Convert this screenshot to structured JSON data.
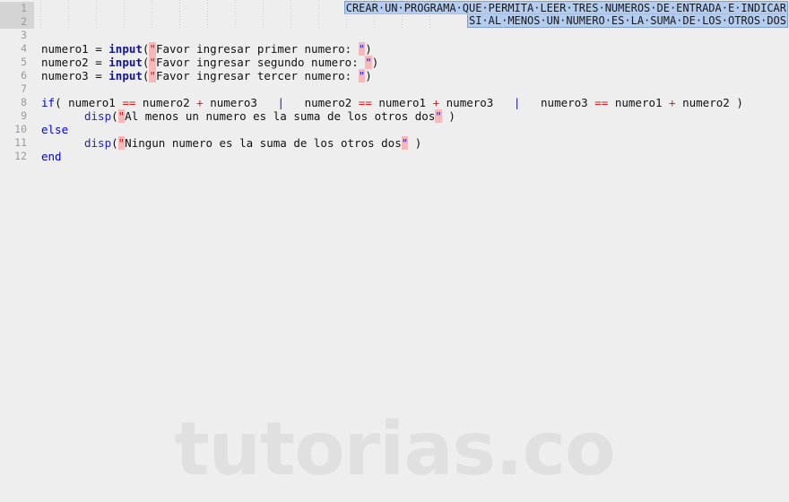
{
  "editor": {
    "background_color": "#eeeeee",
    "gutter_highlight_color": "#d4d4d4",
    "selection_color": "#b4ccee",
    "string_quote_highlight_color": "#f6b8b8"
  },
  "gutter": {
    "line_numbers": [
      "1",
      "2",
      "3",
      "4",
      "5",
      "6",
      "7",
      "8",
      "9",
      "10",
      "11",
      "12"
    ],
    "highlighted_lines": [
      1,
      2
    ]
  },
  "selected_comment": {
    "line1": "CREAR·UN·PROGRAMA·QUE·PERMITA·LEER·TRES·NUMEROS·DE·ENTRADA·E·INDICAR",
    "line2": "SI·AL·MENOS·UN·NUMERO·ES·LA·SUMA·DE·LOS·OTROS·DOS",
    "line1_plain": "CREAR UN PROGRAMA QUE PERMITA LEER TRES NUMEROS DE ENTRADA E INDICAR",
    "line2_plain": "SI AL MENOS UN NUMERO ES LA SUMA DE LOS OTROS DOS"
  },
  "code": {
    "line4": {
      "var": "numero1 = ",
      "fn": "input",
      "open": "(",
      "string": "Favor ingresar primer numero: ",
      "close": ")"
    },
    "line5": {
      "var": "numero2 = ",
      "fn": "input",
      "open": "(",
      "string": "Favor ingresar segundo numero: ",
      "close": ")"
    },
    "line6": {
      "var": "numero3 = ",
      "fn": "input",
      "open": "(",
      "string": "Favor ingresar tercer numero: ",
      "close": ")"
    },
    "line8": {
      "kw": "if",
      "open": "( ",
      "a1": "numero1 ",
      "eq1": "==",
      "a2": " numero2 ",
      "plus1": "+",
      "a3": " numero3",
      "sep1": "   |   ",
      "b1": "numero2 ",
      "eq2": "==",
      "b2": " numero1 ",
      "plus2": "+",
      "b3": " numero3",
      "sep2": "   |   ",
      "c1": "numero3 ",
      "eq3": "==",
      "c2": " numero1 ",
      "plus3": "+",
      "c3": " numero2",
      "close": " )"
    },
    "line9": {
      "fn": "disp",
      "open": "(",
      "string": "Al menos un numero es la suma de los otros dos",
      "close": " )"
    },
    "line10": {
      "kw": "else"
    },
    "line11": {
      "fn": "disp",
      "open": "(",
      "string": "Ningun numero es la suma de los otros dos",
      "close": " )"
    },
    "line12": {
      "kw": "end"
    }
  },
  "watermark": {
    "text": "tutorias.co"
  }
}
